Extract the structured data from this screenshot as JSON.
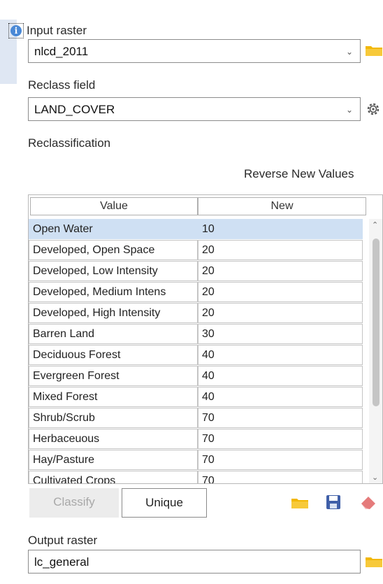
{
  "input_raster": {
    "label": "Input raster",
    "value": "nlcd_2011"
  },
  "reclass_field": {
    "label": "Reclass field",
    "value": "LAND_COVER"
  },
  "reclassification": {
    "label": "Reclassification",
    "reverse_label": "Reverse New Values"
  },
  "table": {
    "headers": {
      "value": "Value",
      "new": "New"
    },
    "rows": [
      {
        "value": "Open Water",
        "new": "10"
      },
      {
        "value": "Developed, Open Space",
        "new": "20"
      },
      {
        "value": "Developed, Low Intensity",
        "new": "20"
      },
      {
        "value": "Developed, Medium Intens",
        "new": "20"
      },
      {
        "value": "Developed, High Intensity",
        "new": "20"
      },
      {
        "value": "Barren Land",
        "new": "30"
      },
      {
        "value": "Deciduous Forest",
        "new": "40"
      },
      {
        "value": "Evergreen Forest",
        "new": "40"
      },
      {
        "value": "Mixed Forest",
        "new": "40"
      },
      {
        "value": "Shrub/Scrub",
        "new": "70"
      },
      {
        "value": "Herbaceuous",
        "new": "70"
      },
      {
        "value": "Hay/Pasture",
        "new": "70"
      },
      {
        "value": "Cultivated Crops",
        "new": "70"
      }
    ]
  },
  "buttons": {
    "classify": "Classify",
    "unique": "Unique"
  },
  "output_raster": {
    "label": "Output raster",
    "value": "lc_general"
  },
  "colors": {
    "accent": "#4a89d6",
    "selected_row": "#cfe0f3",
    "folder": "#f2b705",
    "save": "#3f5fa8"
  }
}
